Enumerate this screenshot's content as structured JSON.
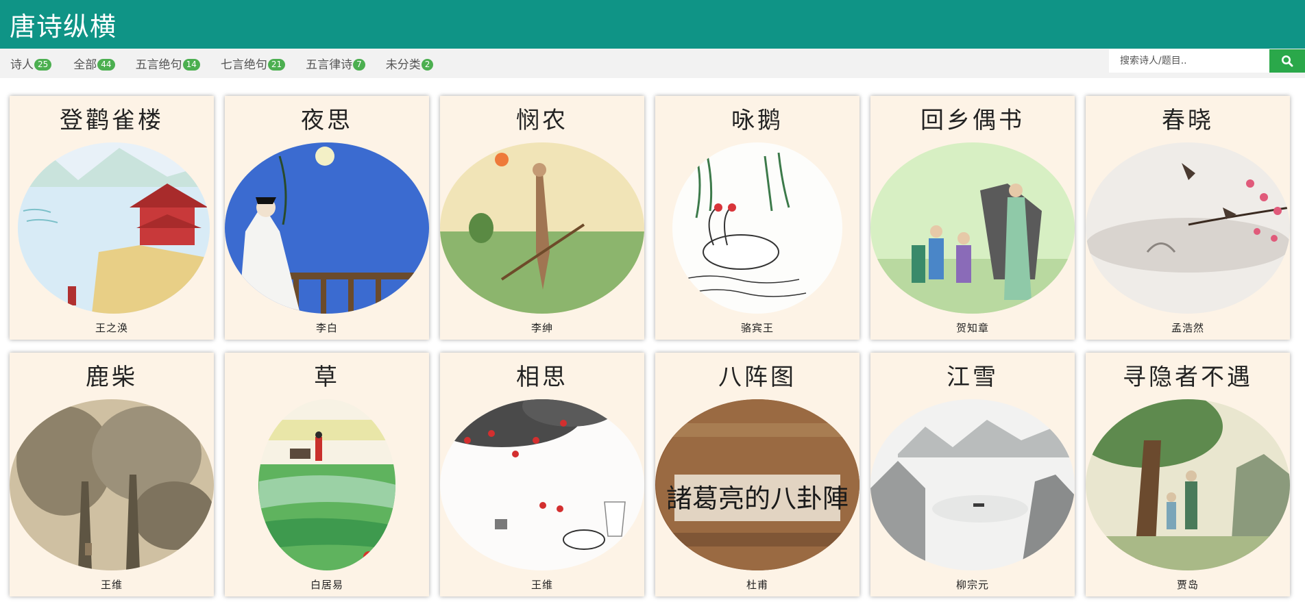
{
  "app": {
    "title": "唐诗纵横"
  },
  "nav": {
    "items": [
      {
        "label": "诗人",
        "count": "25"
      },
      {
        "label": "全部",
        "count": "44"
      },
      {
        "label": "五言绝句",
        "count": "14"
      },
      {
        "label": "七言绝句",
        "count": "21"
      },
      {
        "label": "五言律诗",
        "count": "7"
      },
      {
        "label": "未分类",
        "count": "2"
      }
    ]
  },
  "search": {
    "placeholder": "搜索诗人/题目..",
    "value": "",
    "icon": "search-icon"
  },
  "poems": [
    {
      "title": "登鹳雀楼",
      "author": "王之涣",
      "scene": "tower-river"
    },
    {
      "title": "夜思",
      "author": "李白",
      "scene": "night-moon"
    },
    {
      "title": "悯农",
      "author": "李绅",
      "scene": "farmer-field"
    },
    {
      "title": "咏鹅",
      "author": "骆宾王",
      "scene": "geese-willow"
    },
    {
      "title": "回乡偶书",
      "author": "贺知章",
      "scene": "elder-children"
    },
    {
      "title": "春晓",
      "author": "孟浩然",
      "scene": "birds-blossom"
    },
    {
      "title": "鹿柴",
      "author": "王维",
      "scene": "forest-landscape"
    },
    {
      "title": "草",
      "author": "白居易",
      "scene": "grassland"
    },
    {
      "title": "相思",
      "author": "王维",
      "scene": "red-beans"
    },
    {
      "title": "八阵图",
      "author": "杜甫",
      "scene": "battle-formation",
      "caption": "諸葛亮的八卦陣"
    },
    {
      "title": "江雪",
      "author": "柳宗元",
      "scene": "snow-river"
    },
    {
      "title": "寻隐者不遇",
      "author": "贾岛",
      "scene": "pine-boy"
    }
  ]
}
